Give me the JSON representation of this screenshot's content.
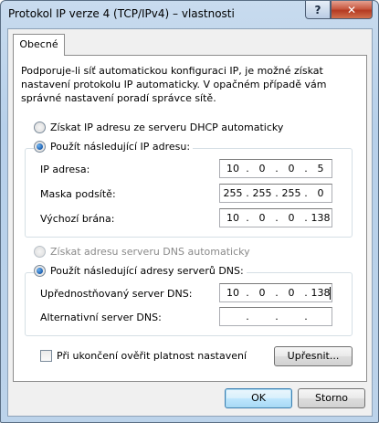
{
  "window": {
    "title": "Protokol IP verze 4 (TCP/IPv4) – vlastnosti",
    "help_glyph": "?",
    "close_glyph": "✕"
  },
  "tabs": [
    {
      "label": "Obecné",
      "selected": true
    }
  ],
  "intro_text": "Podporuje-li síť automatickou konfiguraci IP, je možné získat nastavení protokolu IP automaticky. V opačném případě vám správné nastavení poradí správce sítě.",
  "ip": {
    "auto_option": {
      "label": "Získat IP adresu ze serveru DHCP automaticky",
      "checked": false
    },
    "manual_option": {
      "label": "Použít následující IP adresu:",
      "checked": true
    },
    "fields": [
      {
        "label": "IP adresa:",
        "octets": [
          "10",
          "0",
          "0",
          "5"
        ]
      },
      {
        "label": "Maska podsítě:",
        "octets": [
          "255",
          "255",
          "255",
          "0"
        ]
      },
      {
        "label": "Výchozí brána:",
        "octets": [
          "10",
          "0",
          "0",
          "138"
        ]
      }
    ]
  },
  "dns": {
    "auto_option": {
      "label": "Získat adresu serveru DNS automaticky",
      "checked": false,
      "disabled": true
    },
    "manual_option": {
      "label": "Použít následující adresy serverů DNS:",
      "checked": true
    },
    "fields": [
      {
        "label": "Upřednostňovaný server DNS:",
        "octets": [
          "10",
          "0",
          "0",
          "138"
        ]
      },
      {
        "label": "Alternativní server DNS:",
        "octets": [
          "",
          "",
          "",
          ""
        ]
      }
    ]
  },
  "validate_checkbox": {
    "label": "Při ukončení ověřit platnost nastavení",
    "checked": false
  },
  "buttons": {
    "advanced": "Upřesnit...",
    "ok": "OK",
    "cancel": "Storno"
  },
  "colors": {
    "title_gradient_top": "#c8dbee",
    "close_button": "#c95a42",
    "radio_checked": "#1a5fb0",
    "default_button_border": "#3c7fb1"
  }
}
